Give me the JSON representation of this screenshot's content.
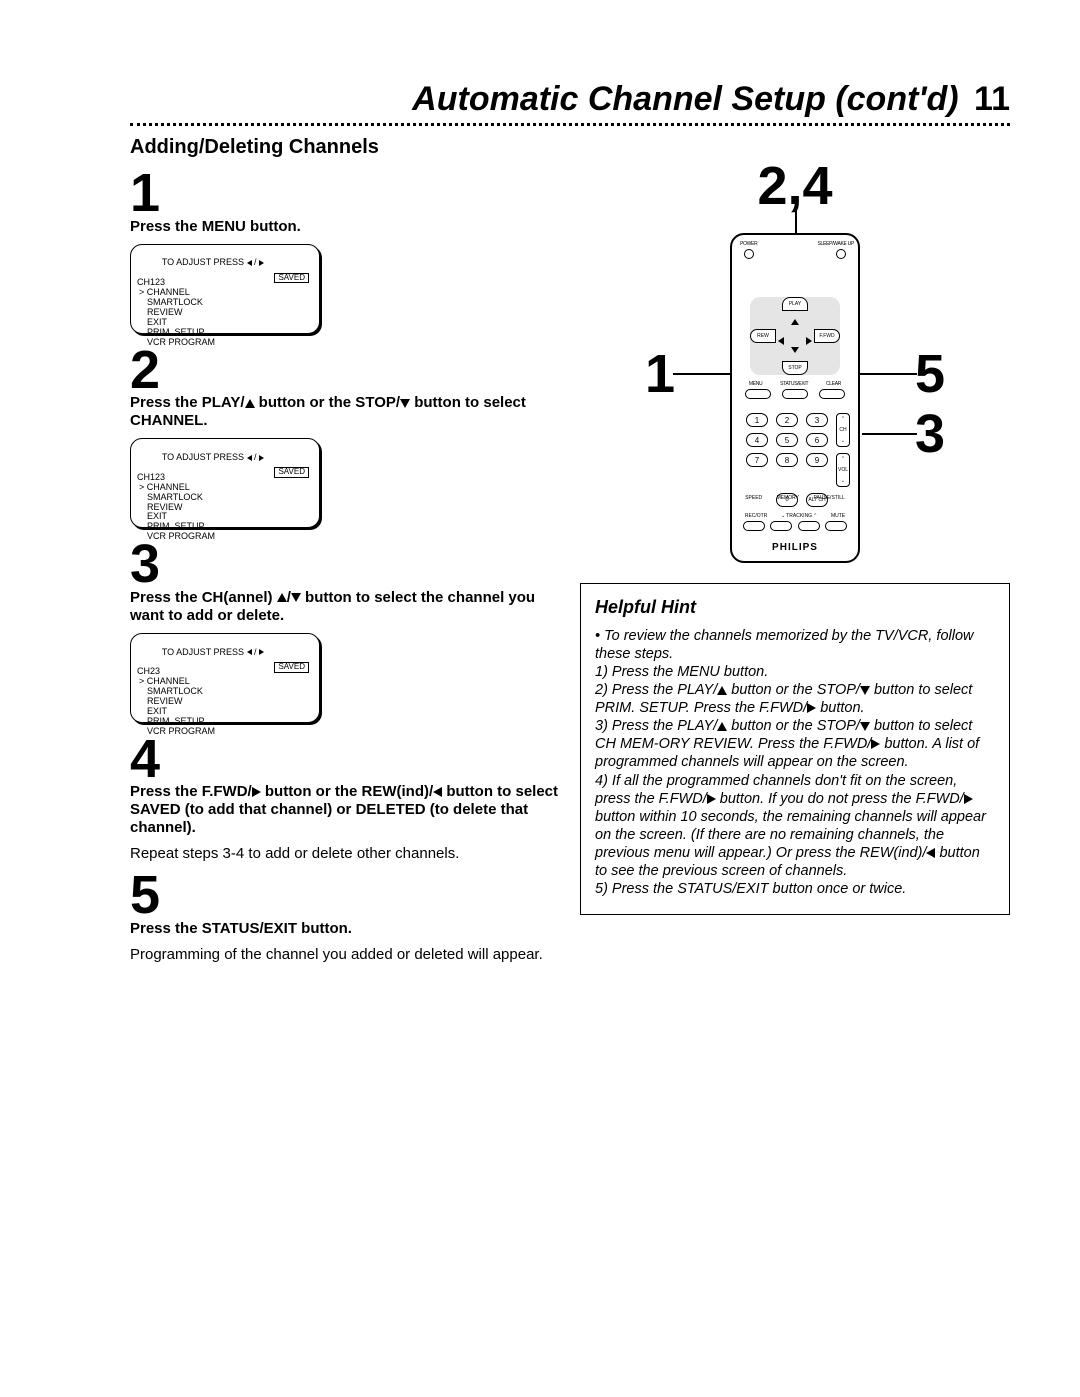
{
  "title": "Automatic Channel Setup (cont'd)",
  "page_number": "11",
  "section_heading": "Adding/Deleting Channels",
  "steps": {
    "s1": {
      "num": "1",
      "text": "Press the MENU button."
    },
    "s2": {
      "num": "2",
      "text_before": "Press the PLAY/",
      "text_mid": " button or the STOP/",
      "text_after": " button to select CHANNEL."
    },
    "s3": {
      "num": "3",
      "text_before": "Press the CH(annel) ",
      "text_mid": "/",
      "text_after": " button to select the channel you want to add or delete."
    },
    "s4": {
      "num": "4",
      "text_before": "Press the F.FWD/",
      "text_mid": " button or the REW(ind)/",
      "text_after": " button to select SAVED (to add that channel) or DELETED (to delete that channel).",
      "sub": "Repeat steps 3-4 to add or delete other channels."
    },
    "s5": {
      "num": "5",
      "text": "Press the STATUS/EXIT button.",
      "sub": "Programming of the channel you added or deleted will appear."
    }
  },
  "osd": {
    "line1_a": "TO ADJUST PRESS ",
    "line1_b": " / ",
    "ch123": "CH123",
    "ch23": "CH23",
    "saved": "SAVED",
    "items": [
      "CHANNEL",
      "SMARTLOCK",
      "REVIEW",
      "EXIT",
      "PRIM. SETUP",
      "VCR PROGRAM"
    ]
  },
  "callouts": {
    "top": "2,4",
    "left": "1",
    "right_top": "5",
    "right_bottom": "3"
  },
  "remote": {
    "power": "POWER",
    "sleep": "SLEEP/WAKE UP",
    "play": "PLAY",
    "stop": "STOP",
    "rew": "REW",
    "ffwd": "F.FWD",
    "menu": "MENU",
    "status": "STATUS/EXIT",
    "clear": "CLEAR",
    "ch": "CH",
    "vol": "VOL",
    "keys": [
      "1",
      "2",
      "3",
      "4",
      "5",
      "6",
      "7",
      "8",
      "9"
    ],
    "zero": "0",
    "altch": "ALT CH",
    "speed": "SPEED",
    "memory": "MEMORY",
    "pause": "PAUSE/STILL",
    "recotr": "REC/OTR",
    "tracking": "TRACKING",
    "mute": "MUTE",
    "brand": "PHILIPS"
  },
  "hint": {
    "title": "Helpful Hint",
    "bullet": "• ",
    "l0": "To review the channels memorized by the TV/VCR, follow these steps.",
    "l1": "1) Press the MENU button.",
    "l2a": "2) Press the PLAY/",
    "l2b": " button or the STOP/",
    "l2c": " button to select PRIM. SETUP. Press the F.FWD/",
    "l2d": " button.",
    "l3a": "3) Press the PLAY/",
    "l3b": " button or the STOP/",
    "l3c": " button to select CH MEM-ORY REVIEW. Press the F.FWD/",
    "l3d": " button. A list of programmed channels will appear on the screen.",
    "l4a": "4) If all the programmed channels don't fit on the screen, press the F.FWD/",
    "l4b": " button. If you do not press the F.FWD/",
    "l4c": " button within 10 seconds, the remaining channels will appear on the screen. (If there are no remaining channels, the previous menu will appear.) Or press the REW(ind)/",
    "l4d": " button to see the previous screen of channels.",
    "l5": "5) Press the STATUS/EXIT button once or twice."
  }
}
